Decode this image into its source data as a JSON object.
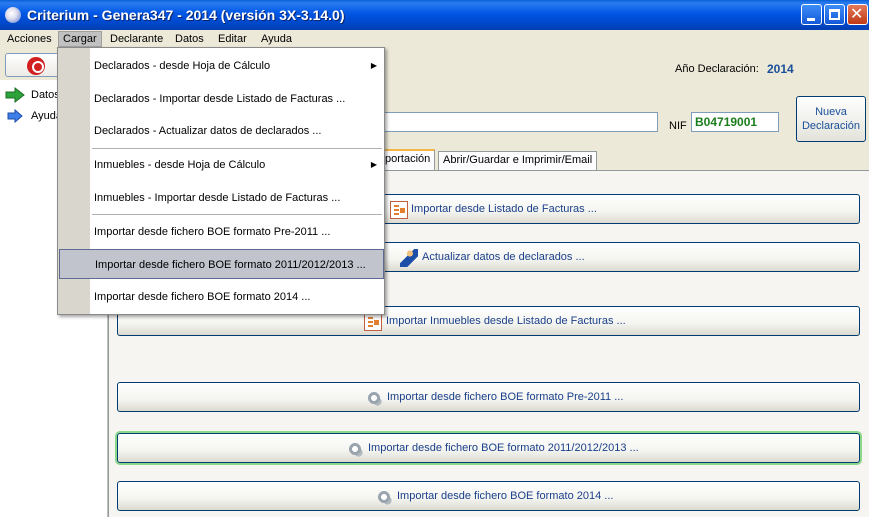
{
  "window": {
    "title": "Criterium - Genera347 - 2014 (versión 3X-3.14.0)",
    "app_icon": "app-logo-icon",
    "buttons": [
      "minimize-icon",
      "maximize-icon",
      "close-icon"
    ]
  },
  "menubar": {
    "items": [
      "Acciones",
      "Cargar",
      "Declarante",
      "Datos",
      "Editar",
      "Ayuda"
    ],
    "active": "Cargar"
  },
  "dropdown": {
    "items": [
      {
        "label": "Declarados - desde Hoja de Cálculo",
        "submenu": true
      },
      {
        "label": "Declarados - Importar desde Listado de Facturas ...",
        "submenu": false
      },
      {
        "label": "Declarados - Actualizar datos de declarados ...",
        "submenu": false
      },
      {
        "label": "Inmuebles - desde Hoja de Cálculo",
        "submenu": true
      },
      {
        "label": "Inmuebles - Importar desde Listado de Facturas ...",
        "submenu": false
      },
      {
        "label": "Importar desde fichero BOE formato Pre-2011 ...",
        "submenu": false
      },
      {
        "label": "Importar desde fichero BOE formato 2011/2012/2013 ...",
        "submenu": false
      },
      {
        "label": "Importar desde fichero BOE formato 2014 ...",
        "submenu": false
      }
    ],
    "highlighted": "Importar desde fichero BOE formato 2011/2012/2013 ..."
  },
  "leftnav": {
    "top_button_label": "C",
    "items": [
      {
        "label": "Datos",
        "icon": "green-arrow-icon"
      },
      {
        "label": "Ayuda",
        "icon": "blue-arrow-icon"
      }
    ]
  },
  "header": {
    "anio_label": "Año Declaración:",
    "anio_value": "2014",
    "nif_label": "NIF",
    "nif_value": "B04719001",
    "nueva_line1": "Nueva",
    "nueva_line2": "Declaración"
  },
  "tabs": [
    {
      "label": "portación",
      "active": true
    },
    {
      "label": "Abrir/Guardar e Imprimir/Email",
      "active": false
    }
  ],
  "actions": [
    {
      "label": "Importar desde Listado de Facturas ...",
      "icon": "list-import-icon"
    },
    {
      "label": "Actualizar datos de declarados ...",
      "icon": "person-pen-icon"
    },
    {
      "label": "Importar Inmuebles desde Listado de Facturas ...",
      "icon": "list-import-icon"
    },
    {
      "label": "Importar desde fichero BOE formato Pre-2011 ...",
      "icon": "gears-icon"
    },
    {
      "label": "Importar desde fichero BOE formato 2011/2012/2013 ...",
      "icon": "gears-icon"
    },
    {
      "label": "Importar desde fichero BOE formato 2014 ...",
      "icon": "gears-icon"
    }
  ],
  "colors": {
    "titlebar": "#0055e5",
    "accent_text": "#1a4f9a",
    "nif_text": "#1b7d1b",
    "focus_glow": "#8bd88b"
  }
}
